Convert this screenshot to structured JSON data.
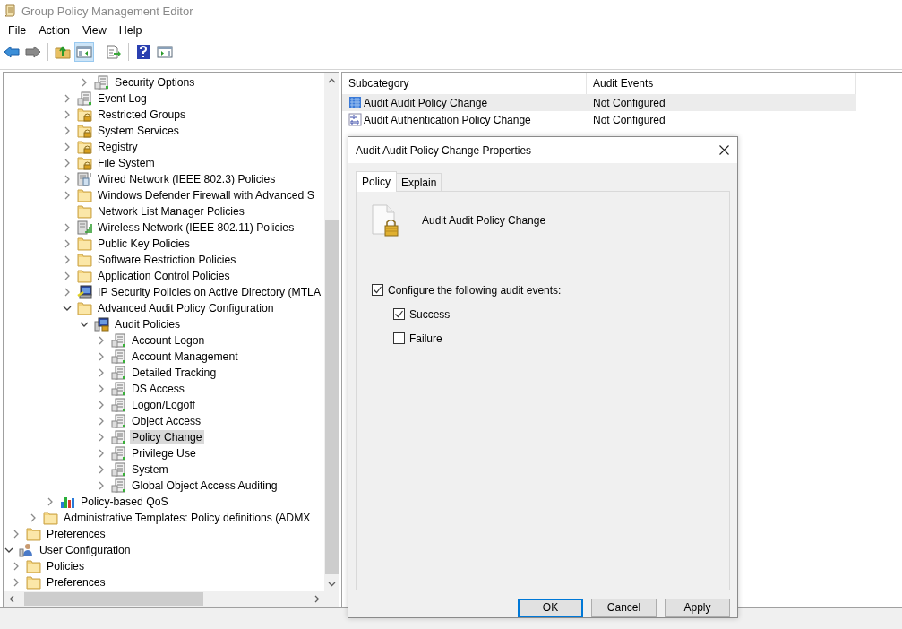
{
  "window": {
    "title": "Group Policy Management Editor"
  },
  "menu": [
    "File",
    "Action",
    "View",
    "Help"
  ],
  "toolbar": [
    {
      "kind": "back",
      "pressed": false
    },
    {
      "kind": "forward",
      "pressed": false
    },
    {
      "kind": "up",
      "pressed": false
    },
    {
      "kind": "tree",
      "pressed": true
    },
    {
      "kind": "export",
      "pressed": false
    },
    {
      "kind": "help",
      "pressed": false
    },
    {
      "kind": "action",
      "pressed": false
    }
  ],
  "tree": [
    {
      "children": [
        {
          "children": [
            {
              "children": [
                {
                  "children": [
                    {
                      "children": [
                        {
                          "label": "Security Options",
                          "kind": "policy",
                          "expandable": true,
                          "expanded": false,
                          "selected": false
                        }
                      ]
                    },
                    {
                      "label": "Event Log",
                      "kind": "policy",
                      "expandable": true,
                      "expanded": false,
                      "selected": false
                    },
                    {
                      "label": "Restricted Groups",
                      "kind": "lock-folder",
                      "expandable": true,
                      "expanded": false,
                      "selected": false
                    },
                    {
                      "label": "System Services",
                      "kind": "lock-folder",
                      "expandable": true,
                      "expanded": false,
                      "selected": false
                    },
                    {
                      "label": "Registry",
                      "kind": "lock-folder",
                      "expandable": true,
                      "expanded": false,
                      "selected": false
                    },
                    {
                      "label": "File System",
                      "kind": "lock-folder",
                      "expandable": true,
                      "expanded": false,
                      "selected": false
                    },
                    {
                      "label": "Wired Network (IEEE 802.3) Policies",
                      "kind": "network",
                      "expandable": true,
                      "expanded": false,
                      "selected": false
                    },
                    {
                      "label": "Windows Defender Firewall with Advanced S",
                      "kind": "folder",
                      "expandable": true,
                      "expanded": false,
                      "selected": false
                    },
                    {
                      "label": "Network List Manager Policies",
                      "kind": "folder",
                      "expandable": false,
                      "selected": false
                    },
                    {
                      "label": "Wireless Network (IEEE 802.11) Policies",
                      "kind": "wireless",
                      "expandable": true,
                      "expanded": false,
                      "selected": false
                    },
                    {
                      "label": "Public Key Policies",
                      "kind": "folder",
                      "expandable": true,
                      "expanded": false,
                      "selected": false
                    },
                    {
                      "label": "Software Restriction Policies",
                      "kind": "folder",
                      "expandable": true,
                      "expanded": false,
                      "selected": false
                    },
                    {
                      "label": "Application Control Policies",
                      "kind": "folder",
                      "expandable": true,
                      "expanded": false,
                      "selected": false
                    },
                    {
                      "label": "IP Security Policies on Active Directory (MTLA",
                      "kind": "ipsec",
                      "expandable": true,
                      "expanded": false,
                      "selected": false
                    },
                    {
                      "label": "Advanced Audit Policy Configuration",
                      "kind": "folder",
                      "expandable": true,
                      "expanded": true,
                      "selected": false,
                      "children": [
                        {
                          "label": "Audit Policies",
                          "kind": "audit",
                          "expandable": true,
                          "expanded": true,
                          "selected": false,
                          "children": [
                            {
                              "label": "Account Logon",
                              "kind": "policy",
                              "expandable": true,
                              "expanded": false,
                              "selected": false
                            },
                            {
                              "label": "Account Management",
                              "kind": "policy",
                              "expandable": true,
                              "expanded": false,
                              "selected": false
                            },
                            {
                              "label": "Detailed Tracking",
                              "kind": "policy",
                              "expandable": true,
                              "expanded": false,
                              "selected": false
                            },
                            {
                              "label": "DS Access",
                              "kind": "policy",
                              "expandable": true,
                              "expanded": false,
                              "selected": false
                            },
                            {
                              "label": "Logon/Logoff",
                              "kind": "policy",
                              "expandable": true,
                              "expanded": false,
                              "selected": false
                            },
                            {
                              "label": "Object Access",
                              "kind": "policy",
                              "expandable": true,
                              "expanded": false,
                              "selected": false
                            },
                            {
                              "label": "Policy Change",
                              "kind": "policy",
                              "expandable": true,
                              "expanded": false,
                              "selected": true
                            },
                            {
                              "label": "Privilege Use",
                              "kind": "policy",
                              "expandable": true,
                              "expanded": false,
                              "selected": false
                            },
                            {
                              "label": "System",
                              "kind": "policy",
                              "expandable": true,
                              "expanded": false,
                              "selected": false
                            },
                            {
                              "label": "Global Object Access Auditing",
                              "kind": "policy",
                              "expandable": true,
                              "expanded": false,
                              "selected": false
                            }
                          ]
                        }
                      ]
                    }
                  ]
                },
                {
                  "label": "Policy-based QoS",
                  "kind": "chart",
                  "expandable": true,
                  "expanded": false,
                  "selected": false
                }
              ]
            },
            {
              "label": "Administrative Templates: Policy definitions (ADMX",
              "kind": "folder",
              "expandable": true,
              "expanded": false,
              "selected": false
            }
          ]
        },
        {
          "label": "Preferences",
          "kind": "folder",
          "expandable": true,
          "expanded": false,
          "selected": false
        }
      ]
    },
    {
      "label": "User Configuration",
      "kind": "user",
      "expandable": true,
      "expanded": true,
      "selected": false,
      "children": [
        {
          "label": "Policies",
          "kind": "folder",
          "expandable": true,
          "expanded": false,
          "selected": false
        },
        {
          "label": "Preferences",
          "kind": "folder",
          "expandable": true,
          "expanded": false,
          "selected": false
        }
      ]
    }
  ],
  "list": {
    "columns": [
      "Subcategory",
      "Audit Events"
    ],
    "rows": [
      {
        "cells": [
          "Audit Audit Policy Change",
          "Not Configured"
        ],
        "kind": "audit-sheet",
        "selected": true
      },
      {
        "cells": [
          "Audit Authentication Policy Change",
          "Not Configured"
        ],
        "kind": "binary",
        "selected": false
      }
    ]
  },
  "dialog": {
    "title": "Audit Audit Policy Change Properties",
    "tabs": [
      {
        "label": "Policy",
        "selected": true
      },
      {
        "label": "Explain",
        "selected": false
      }
    ],
    "policy_name": "Audit Audit Policy Change",
    "options": [
      {
        "label": "Configure the following audit events:",
        "checked": true,
        "children": [
          {
            "label": "Success",
            "checked": true
          },
          {
            "label": "Failure",
            "checked": false
          }
        ]
      }
    ],
    "buttons": [
      {
        "label": "OK",
        "default": true
      },
      {
        "label": "Cancel",
        "default": false
      },
      {
        "label": "Apply",
        "default": false
      }
    ]
  }
}
